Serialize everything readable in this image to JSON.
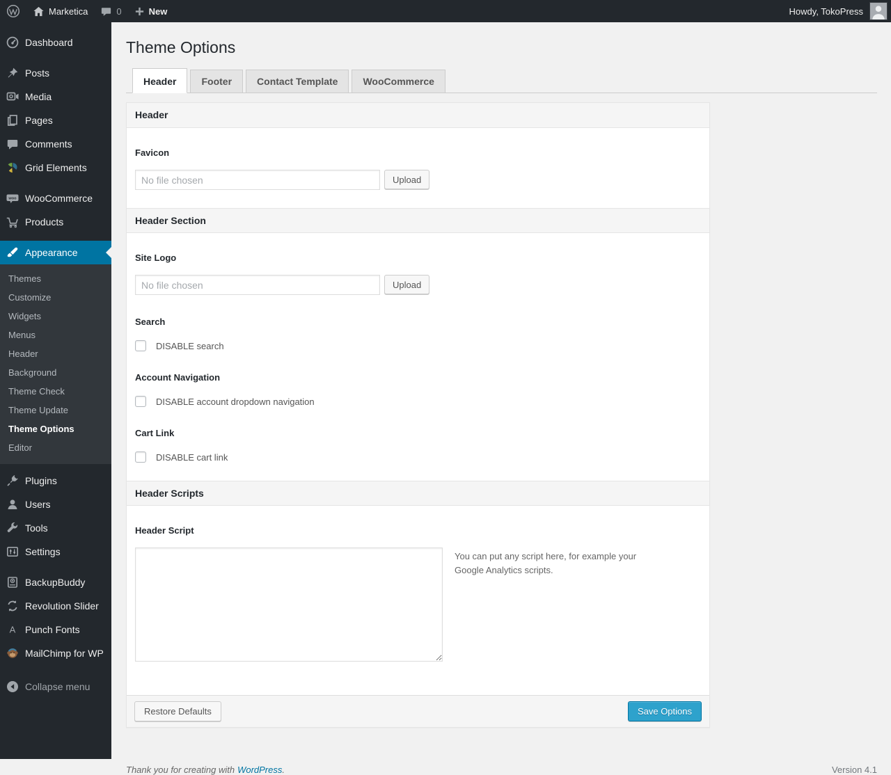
{
  "admin_bar": {
    "site_name": "Marketica",
    "comment_count": "0",
    "new_label": "New",
    "howdy": "Howdy, TokoPress"
  },
  "sidebar": {
    "items": [
      {
        "label": "Dashboard",
        "icon": "dashboard-icon"
      },
      {
        "label": "Posts",
        "icon": "pushpin-icon"
      },
      {
        "label": "Media",
        "icon": "camera-icon"
      },
      {
        "label": "Pages",
        "icon": "pages-icon"
      },
      {
        "label": "Comments",
        "icon": "comment-bubble-icon"
      },
      {
        "label": "Grid Elements",
        "icon": "grid-elements-icon"
      },
      {
        "label": "WooCommerce",
        "icon": "woo-badge-icon"
      },
      {
        "label": "Products",
        "icon": "cart-icon"
      },
      {
        "label": "Appearance",
        "icon": "brush-icon",
        "active": true
      },
      {
        "label": "Plugins",
        "icon": "plug-icon"
      },
      {
        "label": "Users",
        "icon": "user-icon"
      },
      {
        "label": "Tools",
        "icon": "wrench-icon"
      },
      {
        "label": "Settings",
        "icon": "sliders-icon"
      },
      {
        "label": "BackupBuddy",
        "icon": "backup-drive-icon"
      },
      {
        "label": "Revolution Slider",
        "icon": "refresh-arrows-icon"
      },
      {
        "label": "Punch Fonts",
        "icon": "letter-a-icon"
      },
      {
        "label": "MailChimp for WP",
        "icon": "monkey-icon"
      }
    ],
    "submenu": [
      {
        "label": "Themes"
      },
      {
        "label": "Customize"
      },
      {
        "label": "Widgets"
      },
      {
        "label": "Menus"
      },
      {
        "label": "Header"
      },
      {
        "label": "Background"
      },
      {
        "label": "Theme Check"
      },
      {
        "label": "Theme Update"
      },
      {
        "label": "Theme Options",
        "current": true
      },
      {
        "label": "Editor"
      }
    ],
    "collapse_label": "Collapse menu"
  },
  "page": {
    "title": "Theme Options",
    "tabs": [
      {
        "label": "Header",
        "active": true
      },
      {
        "label": "Footer"
      },
      {
        "label": "Contact Template"
      },
      {
        "label": "WooCommerce"
      }
    ]
  },
  "panel": {
    "sections": [
      {
        "title": "Header"
      },
      {
        "title": "Header Section"
      },
      {
        "title": "Header Scripts"
      }
    ],
    "favicon": {
      "label": "Favicon",
      "placeholder": "No file chosen",
      "upload_label": "Upload"
    },
    "site_logo": {
      "label": "Site Logo",
      "placeholder": "No file chosen",
      "upload_label": "Upload"
    },
    "search": {
      "label": "Search",
      "checkbox_label": "DISABLE search",
      "checked": false
    },
    "account_nav": {
      "label": "Account Navigation",
      "checkbox_label": "DISABLE account dropdown navigation",
      "checked": false
    },
    "cart_link": {
      "label": "Cart Link",
      "checkbox_label": "DISABLE cart link",
      "checked": false
    },
    "header_script": {
      "label": "Header Script",
      "value": "",
      "help": "You can put any script here, for example your Google Analytics scripts."
    },
    "footer": {
      "restore_label": "Restore Defaults",
      "save_label": "Save Options"
    }
  },
  "footer": {
    "thanks_text": "Thank you for creating with",
    "link_label": "WordPress",
    "suffix": ".",
    "version": "Version 4.1"
  },
  "colors": {
    "admin_dark": "#23282d",
    "submenu_bg": "#32373c",
    "accent": "#0074a2",
    "primary_button": "#2ea2cc",
    "page_bg": "#f1f1f1",
    "icon_gray": "#a0a5aa"
  }
}
